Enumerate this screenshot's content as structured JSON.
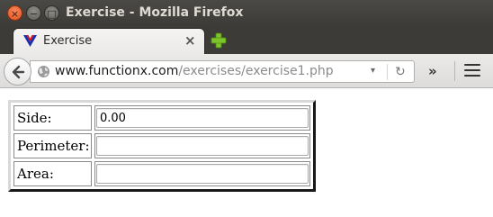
{
  "window": {
    "title": "Exercise - Mozilla Firefox",
    "close_glyph": "×",
    "minimize_glyph": "−",
    "maximize_glyph": "□"
  },
  "tabs": [
    {
      "label": "Exercise",
      "favicon": "functionx-v-icon",
      "close_glyph": "×"
    }
  ],
  "new_tab_icon": "plus-icon",
  "navbar": {
    "back_icon": "back-arrow-icon",
    "url_domain": "www.functionx.com",
    "url_path": "/exercises/exercise1.php",
    "dropdown_glyph": "▾",
    "reload_glyph": "↻",
    "overflow_glyph": "»",
    "menu_icon": "hamburger-menu-icon"
  },
  "form": {
    "rows": [
      {
        "label": "Side:",
        "value": "0.00"
      },
      {
        "label": "Perimeter:",
        "value": ""
      },
      {
        "label": "Area:",
        "value": ""
      }
    ]
  },
  "colors": {
    "titlebar": "#3c3b37",
    "close_button": "#e4541c",
    "tab_active": "#f4f3f2"
  }
}
